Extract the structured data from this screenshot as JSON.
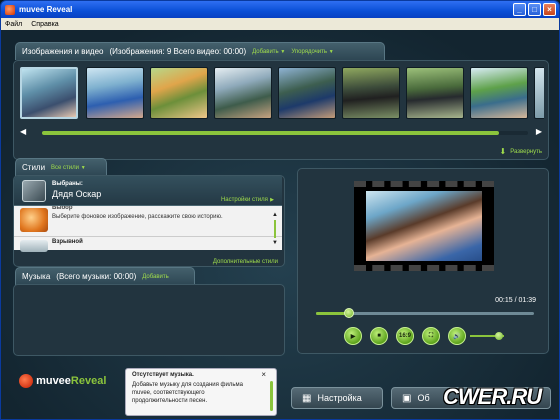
{
  "window": {
    "title": "muvee Reveal"
  },
  "menu": [
    "Файл",
    "Справка"
  ],
  "media": {
    "title": "Изображения и видео",
    "counts": "(Изображения: 9   Всего видео: 00:00)",
    "add": "Добавить",
    "sort": "Упорядочить",
    "expand": "Развернуть",
    "progress": 0.94
  },
  "styles": {
    "title": "Стили",
    "all": "Все стили",
    "selected_label": "Выбраны:",
    "selected_name": "Дядя Оскар",
    "settings": "Настройки стиля",
    "items": [
      {
        "name": "Выбор",
        "desc": "Выберите фоновое изображение, расскажите свою историю."
      },
      {
        "name": "Взрывной",
        "desc": ""
      }
    ],
    "more": "Дополнительные стили"
  },
  "music": {
    "title": "Музыка",
    "total": "(Всего музыки: 00:00)",
    "add": "Добавить"
  },
  "preview": {
    "time": "00:15 / 01:39",
    "position": 0.15,
    "aspect": "16:9",
    "volume": 0.85
  },
  "notice": {
    "title": "Отсутствует музыка.",
    "text": "Добавьте музыку для создания фильма muvee, соответствующего продолжительности песен."
  },
  "logo": {
    "brand1": "muvee",
    "brand2": "Reveal"
  },
  "buttons": {
    "settings": "Настройка",
    "make": "Об"
  },
  "watermark": "CWER.RU",
  "colors": {
    "accent": "#8bc43c",
    "link": "#9fdc4c",
    "titlebar": "#0a4fd6"
  }
}
